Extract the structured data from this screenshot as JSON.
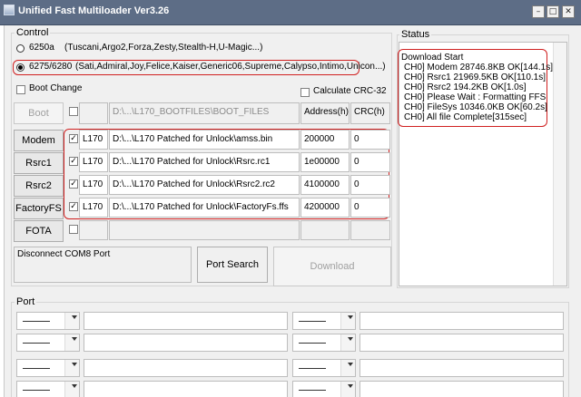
{
  "window": {
    "title": "Unified Fast Multiloader Ver3.26",
    "minimize_glyph": "–",
    "maximize_glyph": "□",
    "close_glyph": "✕"
  },
  "control": {
    "label": "Control",
    "radio_options": [
      {
        "name": "6250a",
        "detail": "(Tuscani,Argo2,Forza,Zesty,Stealth-H,U-Magic...)",
        "selected": false
      },
      {
        "name": "6275/6280",
        "detail": "(Sati,Admiral,Joy,Felice,Kaiser,Generic06,Supreme,Calypso,Intimo,Unicon...)",
        "selected": true
      }
    ],
    "boot_change_label": "Boot Change",
    "calc_crc_label": "Calculate CRC-32",
    "boot_button": "Boot",
    "boot_path": "D:\\...\\L170_BOOTFILES\\BOOT_FILES",
    "address_header": "Address(h)",
    "crc_header": "CRC(h)",
    "rows": [
      {
        "button": "Modem",
        "checked": true,
        "model": "L170",
        "path": "D:\\...\\L170 Patched for Unlock\\amss.bin",
        "address": "200000",
        "crc": "0"
      },
      {
        "button": "Rsrc1",
        "checked": true,
        "model": "L170",
        "path": "D:\\...\\L170 Patched for Unlock\\Rsrc.rc1",
        "address": "1e00000",
        "crc": "0"
      },
      {
        "button": "Rsrc2",
        "checked": true,
        "model": "L170",
        "path": "D:\\...\\L170 Patched for Unlock\\Rsrc2.rc2",
        "address": "4100000",
        "crc": "0"
      },
      {
        "button": "FactoryFS",
        "checked": true,
        "model": "L170",
        "path": "D:\\...\\L170 Patched for Unlock\\FactoryFs.ffs",
        "address": "4200000",
        "crc": "0"
      },
      {
        "button": "FOTA",
        "checked": false,
        "model": "",
        "path": "",
        "address": "",
        "crc": ""
      }
    ],
    "disconnect_text": "Disconnect COM8 Port",
    "port_search_button": "Port Search",
    "download_button": "Download"
  },
  "status": {
    "label": "Status",
    "lines": [
      "Download Start",
      "CH0] Modem 28746.8KB OK[144.1s]",
      "CH0] Rsrc1 21969.5KB OK[110.1s]",
      "CH0] Rsrc2 194.2KB OK[1.0s]",
      "CH0] Please Wait : Formatting FFS",
      "CH0] FileSys 10346.0KB OK[60.2s]",
      "CH0] All file Complete[315sec]"
    ]
  },
  "port": {
    "label": "Port"
  },
  "colors": {
    "title_bar": "#5d6d86",
    "highlight_red": "#d02020",
    "window_bg": "#f0f0f0"
  }
}
